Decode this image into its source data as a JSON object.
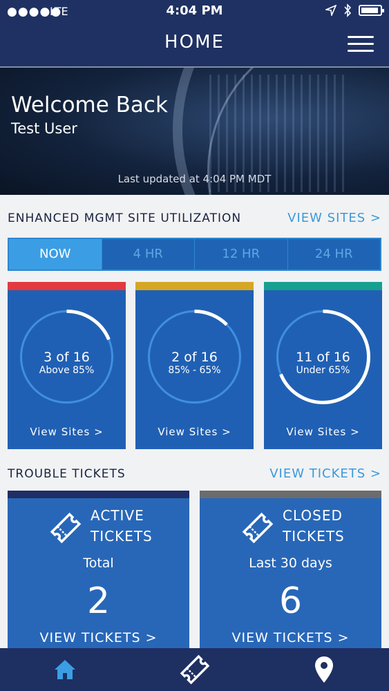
{
  "status_bar": {
    "signal": "●●●●●",
    "carrier": "LTE",
    "time": "4:04 PM"
  },
  "header": {
    "title": "HOME"
  },
  "hero": {
    "welcome": "Welcome Back",
    "user": "Test User",
    "updated": "Last updated at 4:04 PM MDT"
  },
  "utilization": {
    "title": "ENHANCED MGMT SITE UTILIZATION",
    "link": "VIEW SITES >",
    "tabs": [
      "NOW",
      "4 HR",
      "12 HR",
      "24 HR"
    ],
    "cards": [
      {
        "count": "3 of 16",
        "range": "Above 85%",
        "link": "View Sites >",
        "color": "#e23a3f",
        "value": 3,
        "total": 16
      },
      {
        "count": "2 of 16",
        "range": "85% - 65%",
        "link": "View Sites >",
        "color": "#d6a724",
        "value": 2,
        "total": 16
      },
      {
        "count": "11 of 16",
        "range": "Under 65%",
        "link": "View Sites >",
        "color": "#16a08f",
        "value": 11,
        "total": 16
      }
    ]
  },
  "tickets": {
    "title": "TROUBLE TICKETS",
    "link": "VIEW TICKETS >",
    "active": {
      "line1": "ACTIVE",
      "line2": "TICKETS",
      "sub": "Total",
      "num": "2",
      "link": "VIEW TICKETS >",
      "color": "#1f2f66"
    },
    "closed": {
      "line1": "CLOSED",
      "line2": "TICKETS",
      "sub": "Last 30 days",
      "num": "6",
      "link": "VIEW TICKETS >",
      "color": "#6c6c6c"
    }
  },
  "colors": {
    "accent": "#3a9ad9",
    "navy": "#1f3162",
    "card": "#2060b4"
  },
  "icons": [
    "location-arrow-icon",
    "bluetooth-icon",
    "battery-icon",
    "menu-icon",
    "ticket-icon",
    "home-icon",
    "location-pin-icon"
  ]
}
